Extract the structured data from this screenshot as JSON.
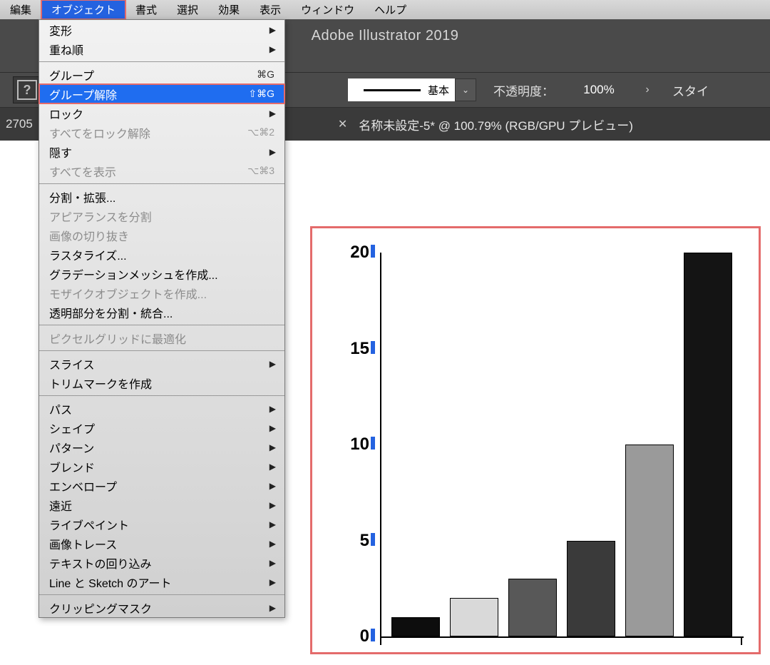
{
  "menubar": {
    "items": [
      "編集",
      "オブジェクト",
      "書式",
      "選択",
      "効果",
      "表示",
      "ウィンドウ",
      "ヘルプ"
    ],
    "selected_index": 1
  },
  "app_title": "Adobe Illustrator 2019",
  "controlbar": {
    "stroke_label": "基本",
    "opacity_label": "不透明度：",
    "opacity_value": "100%",
    "style_label": "スタイ"
  },
  "tabbar": {
    "left_text": "2705",
    "tab_label": "名称未設定-5* @ 100.79% (RGB/GPU プレビュー)"
  },
  "dropdown": {
    "rows": [
      {
        "label": "変形",
        "arrow": true
      },
      {
        "label": "重ね順",
        "arrow": true
      },
      {
        "sep": true
      },
      {
        "label": "グループ",
        "shortcut": "⌘G"
      },
      {
        "label": "グループ解除",
        "shortcut": "⇧⌘G",
        "highlight": true
      },
      {
        "label": "ロック",
        "arrow": true
      },
      {
        "label": "すべてをロック解除",
        "shortcut": "⌥⌘2",
        "disabled": true
      },
      {
        "label": "隠す",
        "arrow": true
      },
      {
        "label": "すべてを表示",
        "shortcut": "⌥⌘3",
        "disabled": true
      },
      {
        "sep": true
      },
      {
        "label": "分割・拡張..."
      },
      {
        "label": "アピアランスを分割",
        "disabled": true
      },
      {
        "label": "画像の切り抜き",
        "disabled": true
      },
      {
        "label": "ラスタライズ..."
      },
      {
        "label": "グラデーションメッシュを作成..."
      },
      {
        "label": "モザイクオブジェクトを作成...",
        "disabled": true
      },
      {
        "label": "透明部分を分割・統合..."
      },
      {
        "sep": true
      },
      {
        "label": "ピクセルグリッドに最適化",
        "disabled": true
      },
      {
        "sep": true
      },
      {
        "label": "スライス",
        "arrow": true
      },
      {
        "label": "トリムマークを作成"
      },
      {
        "sep": true
      },
      {
        "label": "パス",
        "arrow": true
      },
      {
        "label": "シェイプ",
        "arrow": true
      },
      {
        "label": "パターン",
        "arrow": true
      },
      {
        "label": "ブレンド",
        "arrow": true
      },
      {
        "label": "エンベロープ",
        "arrow": true
      },
      {
        "label": "遠近",
        "arrow": true
      },
      {
        "label": "ライブペイント",
        "arrow": true
      },
      {
        "label": "画像トレース",
        "arrow": true
      },
      {
        "label": "テキストの回り込み",
        "arrow": true
      },
      {
        "label": "Line と Sketch のアート",
        "arrow": true
      },
      {
        "sep": true
      },
      {
        "label": "クリッピングマスク",
        "arrow": true
      }
    ]
  },
  "chart_data": {
    "type": "bar",
    "categories": [
      "",
      "",
      "",
      "",
      "",
      ""
    ],
    "values": [
      1,
      2,
      3,
      5,
      10,
      20
    ],
    "title": "",
    "xlabel": "",
    "ylabel": "",
    "ylim": [
      0,
      20
    ],
    "yticks": [
      0,
      5,
      10,
      15,
      20
    ],
    "bar_colors": [
      "#0d0d0d",
      "#d9d9d9",
      "#585858",
      "#3a3a3a",
      "#9a9a9a",
      "#141414"
    ]
  }
}
